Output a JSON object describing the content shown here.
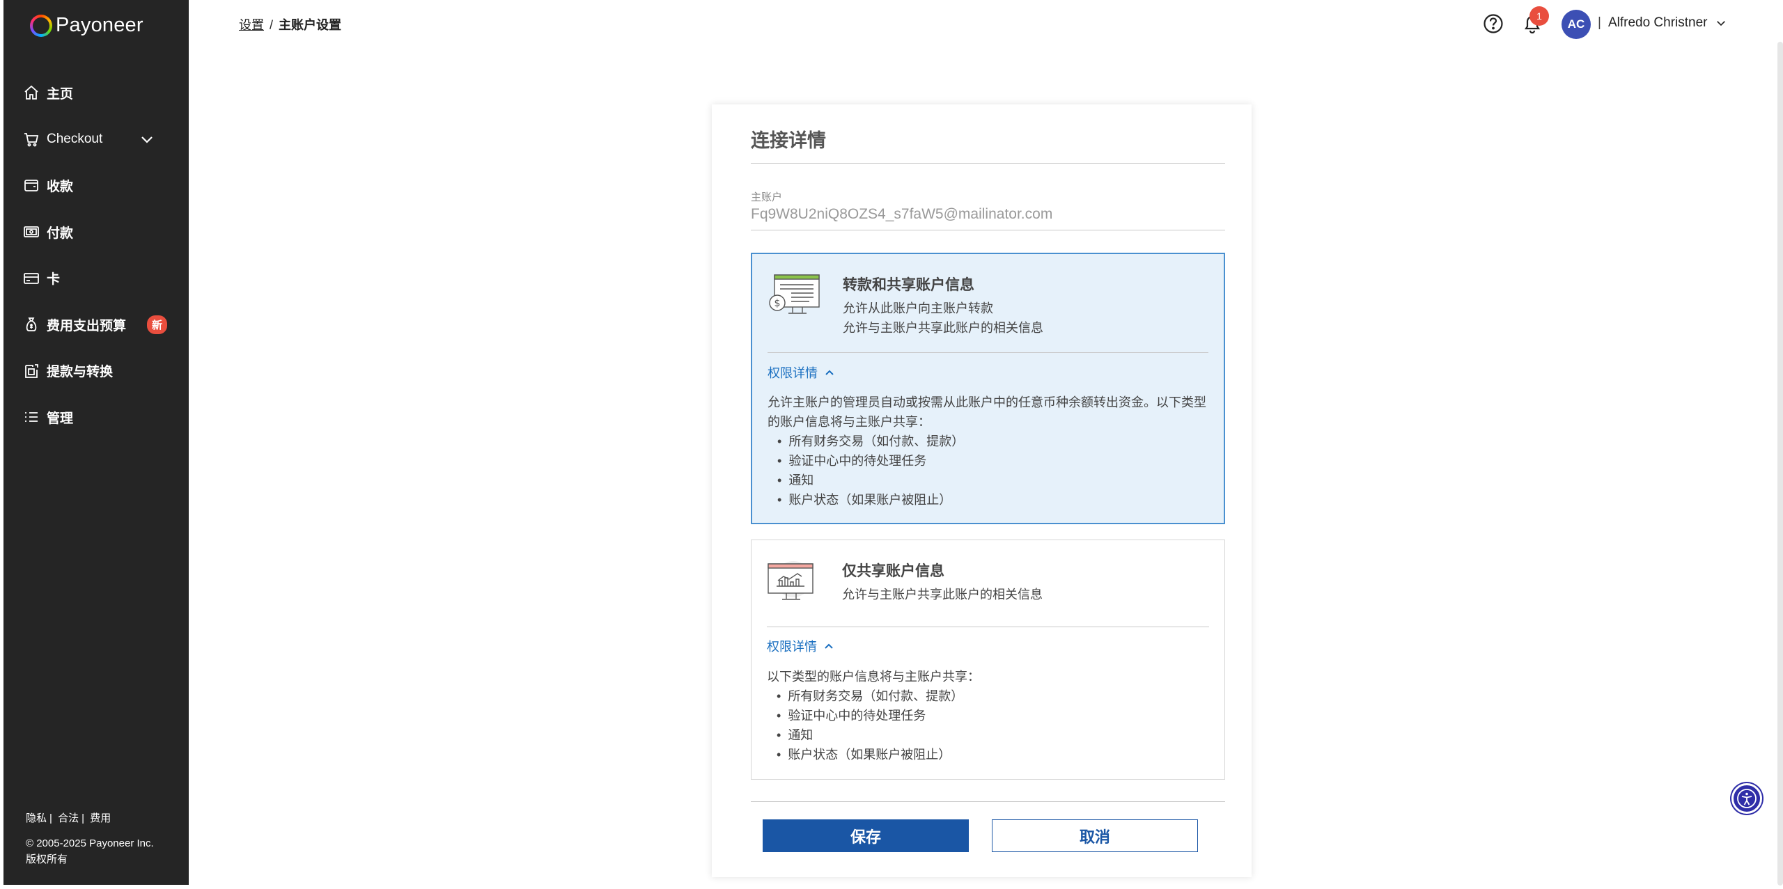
{
  "brand": {
    "name": "Payoneer"
  },
  "sidebar": {
    "items": [
      {
        "label": "主页",
        "icon": "home-icon"
      },
      {
        "label": "Checkout",
        "icon": "cart-icon"
      },
      {
        "label": "收款",
        "icon": "wallet-icon"
      },
      {
        "label": "付款",
        "icon": "payment-icon"
      },
      {
        "label": "卡",
        "icon": "card-icon"
      },
      {
        "label": "费用支出预算",
        "icon": "money-bag-icon",
        "badge": "新"
      },
      {
        "label": "提款与转换",
        "icon": "withdraw-icon"
      },
      {
        "label": "管理",
        "icon": "list-icon"
      }
    ],
    "footer": {
      "privacy": "隐私",
      "legal": "合法",
      "fees": "费用",
      "copyright": "© 2005-2025 Payoneer Inc.",
      "rights": "版权所有"
    }
  },
  "header": {
    "breadcrumb": {
      "parent": "设置",
      "separator": "/",
      "current": "主账户设置"
    },
    "notification_count": "1",
    "user": {
      "initials": "AC",
      "name": "Alfredo Christner"
    }
  },
  "card": {
    "title": "连接详情",
    "master_label": "主账户",
    "master_value": "Fq9W8U2niQ8OZS4_s7faW5@mailinator.com",
    "options": [
      {
        "title": "转款和共享账户信息",
        "desc1": "允许从此账户向主账户转款",
        "desc2": "允许与主账户共享此账户的相关信息",
        "perm_toggle": "权限详情",
        "perm_intro": "允许主账户的管理员自动或按需从此账户中的任意币种余额转出资金。以下类型的账户信息将与主账户共享：",
        "perm_items": [
          "所有财务交易（如付款、提款）",
          "验证中心中的待处理任务",
          "通知",
          "账户状态（如果账户被阻止）"
        ]
      },
      {
        "title": "仅共享账户信息",
        "desc1": "允许与主账户共享此账户的相关信息",
        "perm_toggle": "权限详情",
        "perm_intro": "以下类型的账户信息将与主账户共享：",
        "perm_items": [
          "所有财务交易（如付款、提款）",
          "验证中心中的待处理任务",
          "通知",
          "账户状态（如果账户被阻止）"
        ]
      }
    ],
    "save_label": "保存",
    "cancel_label": "取消"
  },
  "colors": {
    "sidebar_bg": "#252525",
    "primary": "#1a56a5",
    "link": "#1a6fc0",
    "selected_bg": "#e6f1fa",
    "badge": "#e94e3e"
  }
}
